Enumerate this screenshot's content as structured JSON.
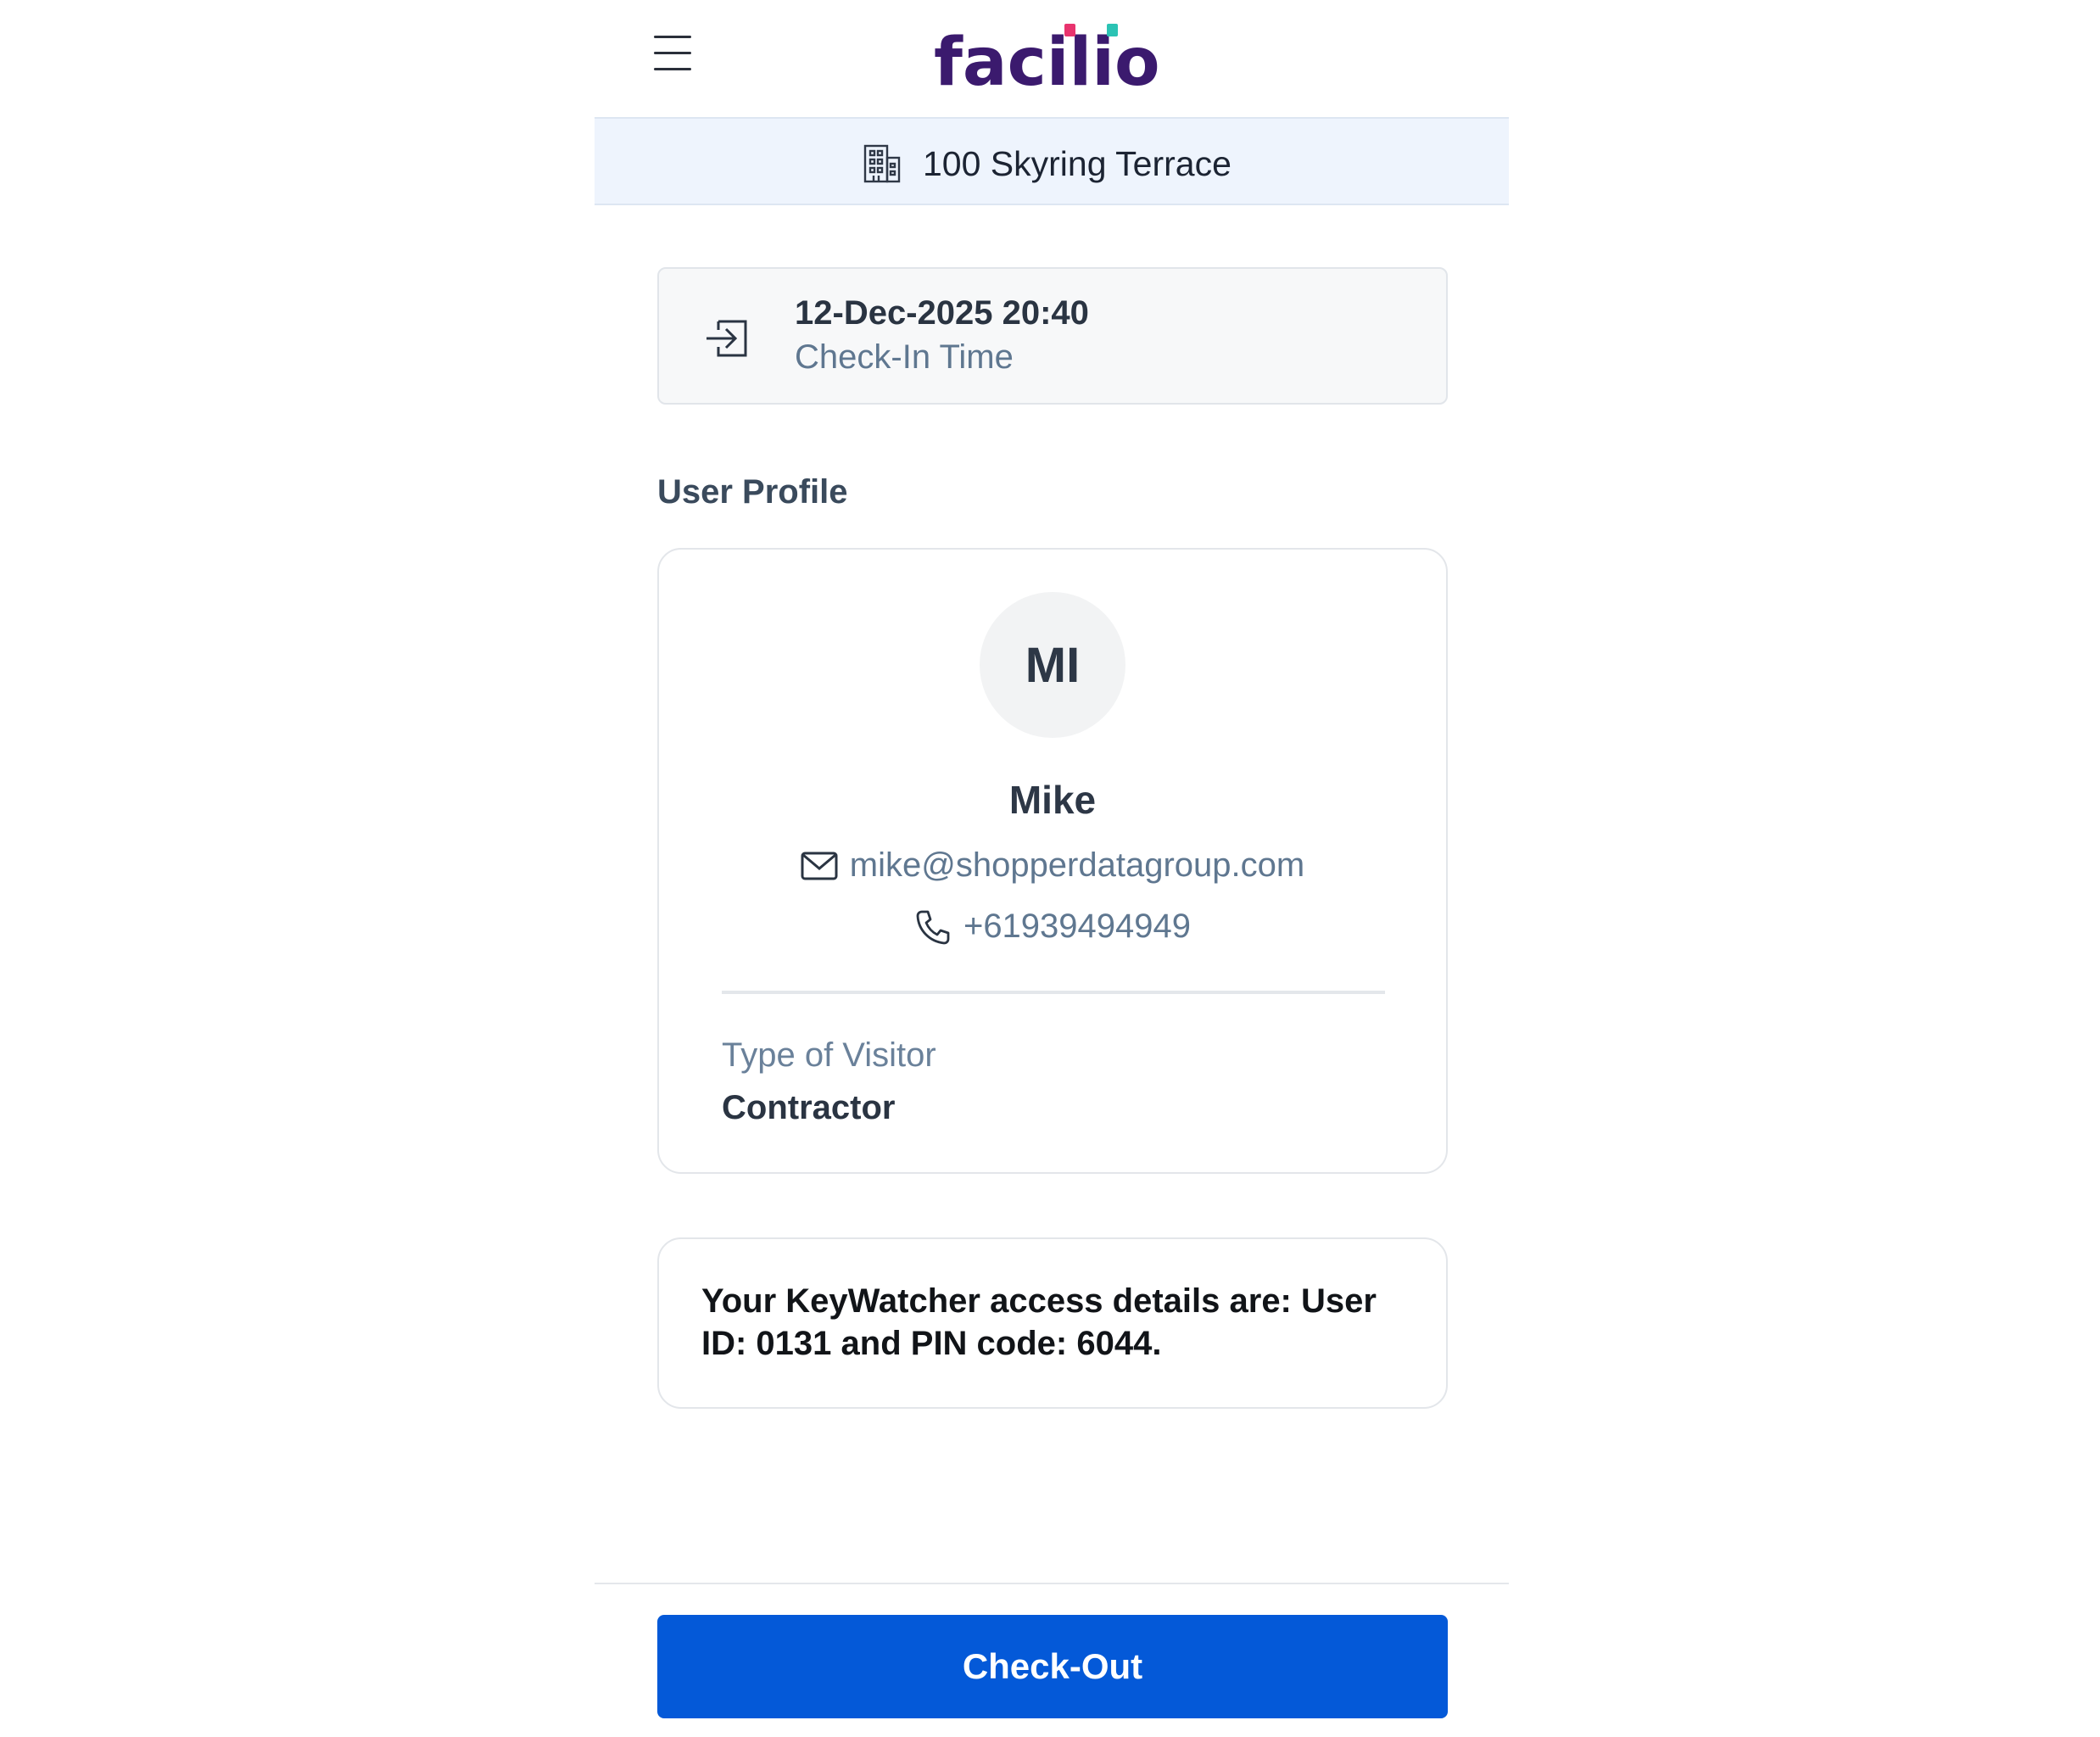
{
  "header": {
    "logo_text": "facilio",
    "menu_icon": "hamburger-menu-icon"
  },
  "location": {
    "icon": "building-icon",
    "name": "100 Skyring Terrace"
  },
  "checkin": {
    "icon": "check-in-icon",
    "time": "12-Dec-2025 20:40",
    "label": "Check-In Time"
  },
  "profile": {
    "section_title": "User Profile",
    "initials": "MI",
    "name": "Mike",
    "email_icon": "mail-icon",
    "email": "mike@shopperdatagroup.com",
    "phone_icon": "phone-icon",
    "phone": "+61939494949",
    "visitor_type_label": "Type of Visitor",
    "visitor_type": "Contractor"
  },
  "message": {
    "text": "Your KeyWatcher access details are: User ID: 0131 and PIN code: 6044."
  },
  "footer": {
    "checkout_label": "Check-Out"
  },
  "colors": {
    "brand_purple": "#3b1a6e",
    "accent_pink": "#e8336e",
    "accent_teal": "#2bc3b4",
    "primary_button": "#0459d8",
    "location_bar_bg": "#eef4fd"
  }
}
